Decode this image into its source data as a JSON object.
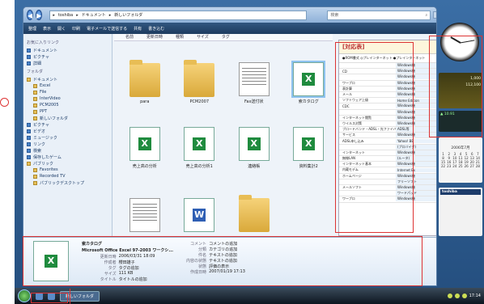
{
  "window": {
    "nav_back": "◀",
    "nav_forward": "▶",
    "address": [
      "toshiba",
      "ドキュメント",
      "新しいフォルダ"
    ],
    "search_label": "検索",
    "search_icon": "magnifier-icon"
  },
  "toolbar": [
    "整理",
    "表示",
    "開く",
    "印刷",
    "電子メールで送信する",
    "共有",
    "書き込む"
  ],
  "nav": {
    "favorites_title": "お気に入りリンク",
    "favorites": [
      "ドキュメント",
      "ピクチャ",
      "詳細"
    ],
    "folders_title": "フォルダ",
    "folders": [
      "ドキュメント",
      "Excel",
      "File",
      "InterVideo",
      "PCM2005",
      "PPT",
      "新しいフォルダ",
      "ピクチャ",
      "ビデオ",
      "ミュージック",
      "リンク",
      "検索",
      "保存したゲーム",
      "パブリック",
      "Favorites",
      "Recorded TV",
      "パブリックデスクトップ"
    ]
  },
  "columns": [
    "名前",
    "更新日時",
    "種類",
    "サイズ",
    "タグ"
  ],
  "files": [
    {
      "name": "para",
      "kind": "folder"
    },
    {
      "name": "PCM2007",
      "kind": "folder"
    },
    {
      "name": "Fax送付状",
      "kind": "doc"
    },
    {
      "name": "索カタログ",
      "kind": "xls",
      "selected": true
    },
    {
      "name": "売上高の分析",
      "kind": "xls"
    },
    {
      "name": "売上高の分析1",
      "kind": "xls"
    },
    {
      "name": "連絡帳",
      "kind": "xls"
    },
    {
      "name": "資料集計2",
      "kind": "xls"
    },
    {
      "name": "",
      "kind": "doc"
    },
    {
      "name": "",
      "kind": "word"
    },
    {
      "name": "",
      "kind": "folder"
    },
    {
      "name": "",
      "kind": "empty"
    }
  ],
  "preview": {
    "title": "[対応表]",
    "header": "●ROM書式  ◎プレインターネット  ●プレインターネット",
    "rows": [
      [
        "",
        "Windows機"
      ],
      [
        "CD",
        "Windows機"
      ],
      [
        "",
        "Windows機"
      ],
      [
        "ワープロ",
        "Windows機"
      ],
      [
        "表計算",
        "Windows機"
      ],
      [
        "メール",
        "Windows機"
      ],
      [
        "ソフトウェア上級",
        "Home Edition"
      ],
      [
        "CDC",
        "Windows機"
      ],
      [
        "",
        "Windows機"
      ],
      [
        "インターネット閲覧",
        "Windows機"
      ],
      [
        "ウイルス対策",
        "Windows機"
      ],
      [
        "ブロードバンド・ADSL・光ファイバー",
        "ADSL等"
      ],
      [
        "サービス",
        "Windows機"
      ],
      [
        "ADSL申し込み",
        "Yahoo! BB"
      ],
      [
        "",
        "(プロバイダ)"
      ],
      [
        "インターネット",
        "Windows機"
      ],
      [
        "無線LAN",
        "(ルータ)"
      ],
      [
        "インターネット基本",
        "Windows機"
      ],
      [
        "内蔵モデム",
        "Internet Ex"
      ],
      [
        "ホームページ",
        "Windows機"
      ],
      [
        "",
        "フリーソフト"
      ],
      [
        "メールソフト",
        "Windows機"
      ],
      [
        "",
        "ワードパッド"
      ],
      [
        "ワープロ",
        "Windows機"
      ]
    ]
  },
  "details": {
    "name": "索カタログ",
    "type": "Microsoft Office Excel 97-2003 ワークシ...",
    "left": [
      [
        "更新日時",
        "2006/03/31 18:09"
      ],
      [
        "作成者",
        "櫻田雄子"
      ],
      [
        "タグ",
        "タグの追加"
      ],
      [
        "サイズ",
        "111 KB"
      ],
      [
        "タイトル",
        "タイトルの追加"
      ]
    ],
    "right": [
      [
        "コメント",
        "コメントの追加"
      ],
      [
        "分類",
        "カテゴリの追加"
      ],
      [
        "件名",
        "テキストの追加"
      ],
      [
        "内容の状態",
        "テキストの追加"
      ],
      [
        "状態",
        "評価の表示"
      ],
      [
        "作成日時",
        "2007/01/19 17:13"
      ]
    ]
  },
  "gadgets": {
    "stock": [
      [
        "",
        "1,000"
      ],
      [
        "",
        "112,100"
      ]
    ],
    "weather": "▲ 10.91",
    "calendar_month": "2006年7月",
    "calendar_days": [
      "1",
      "2",
      "3",
      "4",
      "5",
      "6",
      "7",
      "8",
      "9",
      "10",
      "11",
      "12",
      "13",
      "14",
      "15",
      "16",
      "17",
      "18",
      "19",
      "20",
      "21",
      "22",
      "23",
      "24",
      "25",
      "26",
      "27",
      "28"
    ],
    "feeds_title": "toshiba"
  },
  "taskbar": {
    "task": "新しいフォルダ",
    "clock": "17:14"
  }
}
